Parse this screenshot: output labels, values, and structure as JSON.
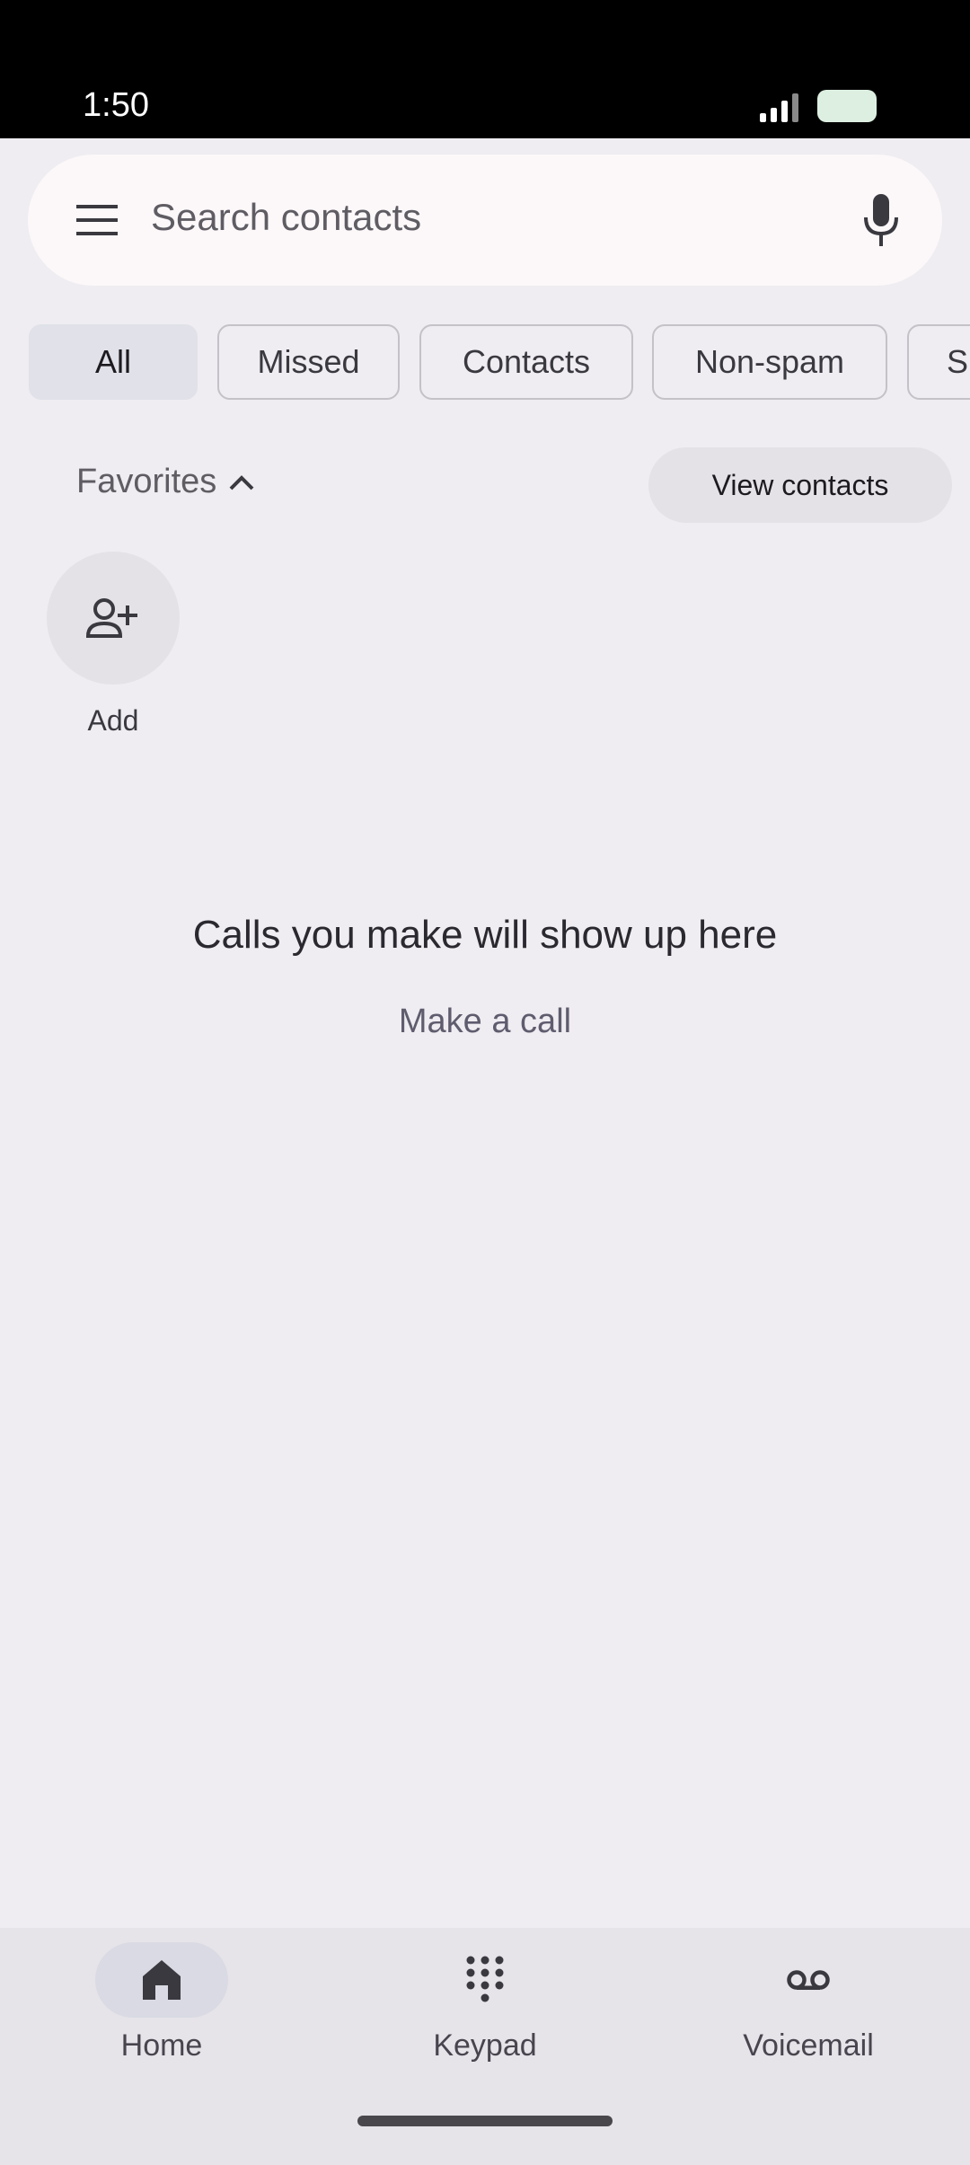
{
  "status_bar": {
    "time": "1:50"
  },
  "search": {
    "placeholder": "Search contacts"
  },
  "filters": [
    {
      "label": "All",
      "active": true
    },
    {
      "label": "Missed",
      "active": false
    },
    {
      "label": "Contacts",
      "active": false
    },
    {
      "label": "Non-spam",
      "active": false
    },
    {
      "label": "Sp",
      "active": false
    }
  ],
  "favorites": {
    "label": "Favorites",
    "view_contacts": "View contacts",
    "add_label": "Add"
  },
  "empty_state": {
    "title": "Calls you make will show up here",
    "action": "Make a call"
  },
  "bottom_nav": [
    {
      "label": "Home",
      "icon": "home-icon",
      "active": true
    },
    {
      "label": "Keypad",
      "icon": "keypad-icon",
      "active": false
    },
    {
      "label": "Voicemail",
      "icon": "voicemail-icon",
      "active": false
    }
  ],
  "colors": {
    "background": "#EFEDF1",
    "active_chip": "#E0E1E9",
    "nav_bg": "#E6E4E9"
  }
}
